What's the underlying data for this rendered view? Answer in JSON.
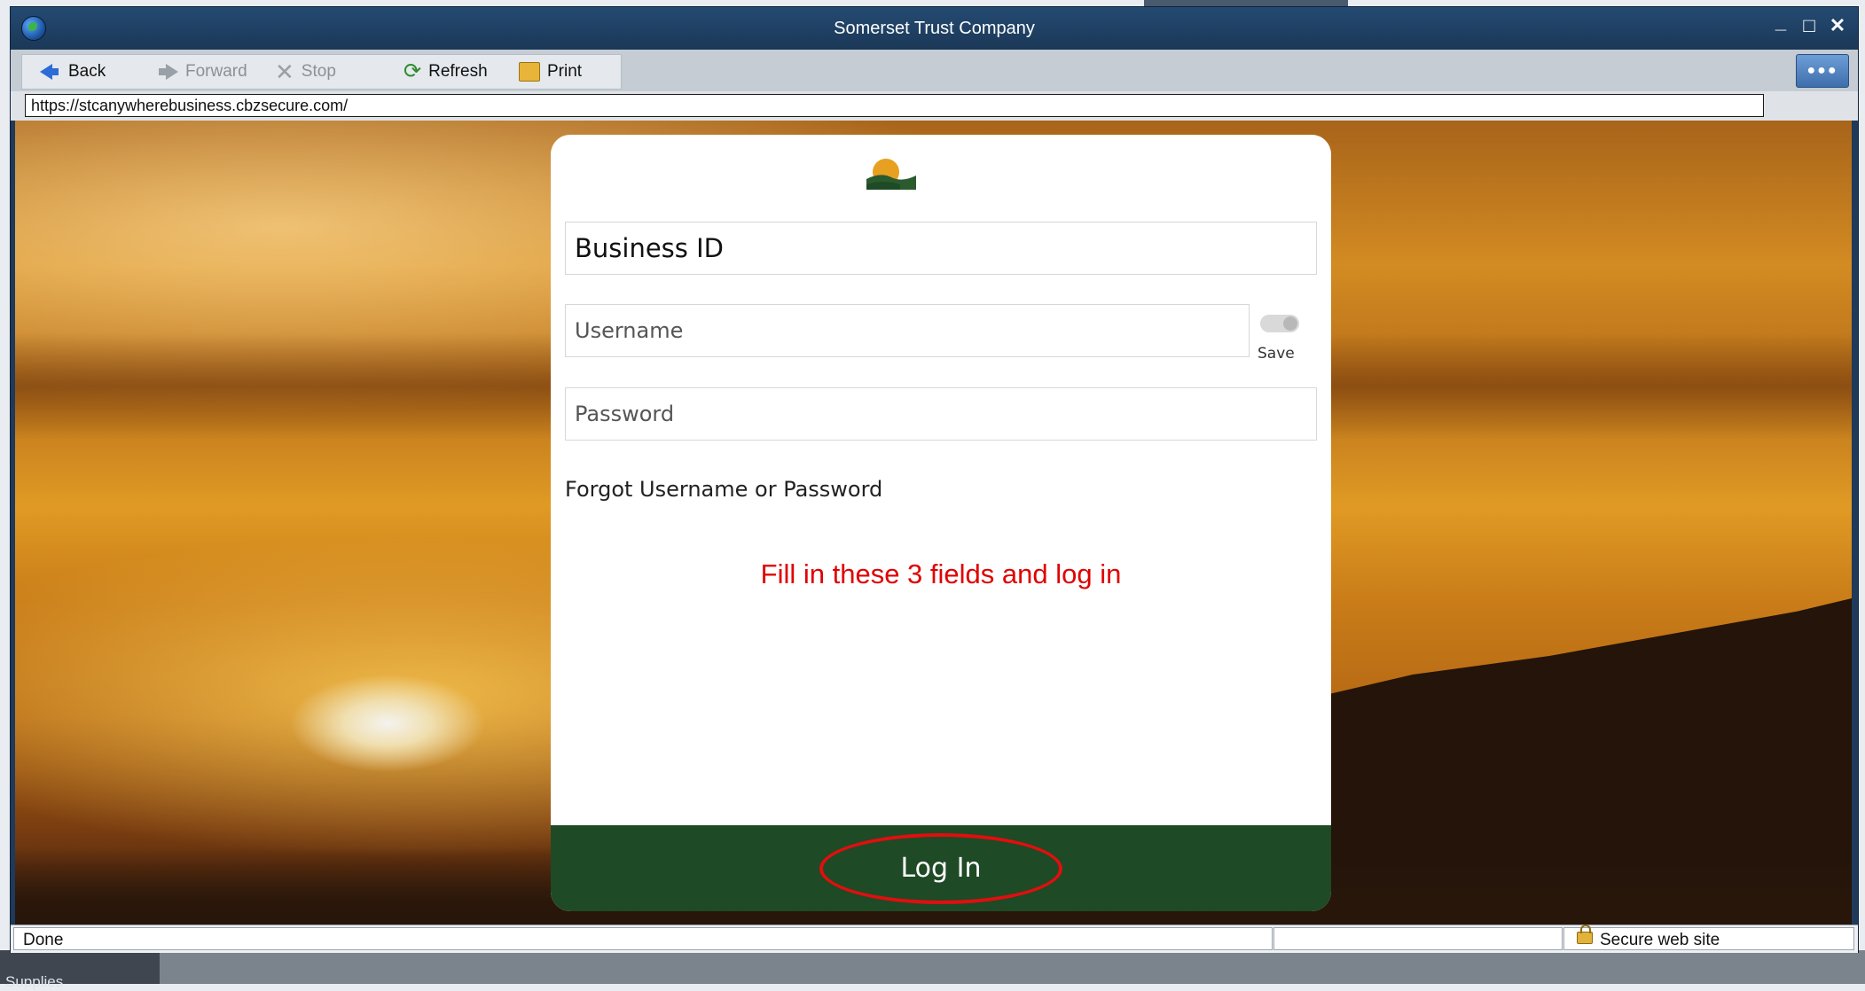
{
  "window": {
    "title": "Somerset Trust Company"
  },
  "toolbar": {
    "back": "Back",
    "forward": "Forward",
    "stop": "Stop",
    "refresh": "Refresh",
    "print": "Print"
  },
  "address": {
    "url": "https://stcanywherebusiness.cbzsecure.com/"
  },
  "login": {
    "business_id_placeholder": "Business ID",
    "username_placeholder": "Username",
    "password_placeholder": "Password",
    "save_label": "Save",
    "forgot_link": "Forgot Username or Password",
    "button_label": "Log In"
  },
  "annotation": {
    "text": "Fill in these 3 fields and log in",
    "color": "#e00000"
  },
  "status": {
    "left": "Done",
    "right": "Secure web site"
  },
  "desktop": {
    "taskbar_label": "Supplies"
  },
  "colors": {
    "brand_green": "#1e4a25",
    "title_bar": "#1f3a5a",
    "annotation_red": "#e20e0e"
  }
}
